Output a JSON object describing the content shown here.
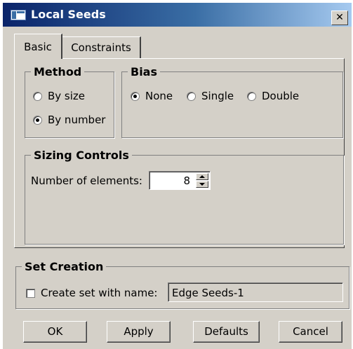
{
  "window": {
    "title": "Local Seeds",
    "close_glyph": "✕"
  },
  "tabs": [
    {
      "label": "Basic",
      "active": true
    },
    {
      "label": "Constraints",
      "active": false
    }
  ],
  "method": {
    "legend": "Method",
    "options": [
      {
        "label": "By size",
        "checked": false
      },
      {
        "label": "By number",
        "checked": true
      }
    ]
  },
  "bias": {
    "legend": "Bias",
    "options": [
      {
        "label": "None",
        "checked": true
      },
      {
        "label": "Single",
        "checked": false
      },
      {
        "label": "Double",
        "checked": false
      }
    ]
  },
  "sizing": {
    "legend": "Sizing Controls",
    "num_label": "Number of elements:",
    "num_value": "8"
  },
  "set_creation": {
    "legend": "Set Creation",
    "checkbox_label": "Create set with name:",
    "checked": false,
    "set_name": "Edge Seeds-1"
  },
  "buttons": {
    "ok": "OK",
    "apply": "Apply",
    "defaults": "Defaults",
    "cancel": "Cancel"
  },
  "colors": {
    "face": "#d4d0c8",
    "title_start": "#0a246a",
    "title_end": "#a6caf0"
  },
  "icons": {
    "app": "app-window-icon",
    "close": "close-icon",
    "spin_up": "spin-up-arrow-icon",
    "spin_down": "spin-down-arrow-icon"
  }
}
